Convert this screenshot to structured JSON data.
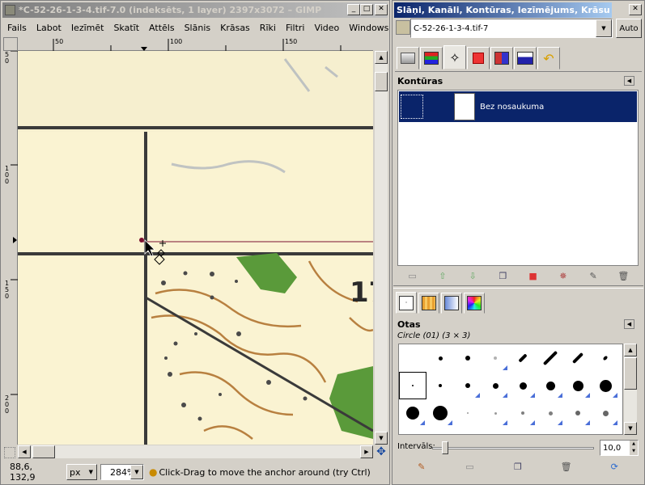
{
  "image_window": {
    "title": "*C-52-26-1-3-4.tif-7.0 (indeksēts, 1 layer) 2397x3072 – GIMP",
    "menu": [
      "Fails",
      "Labot",
      "Iezīmēt",
      "Skatīt",
      "Attēls",
      "Slānis",
      "Krāsas",
      "Rīki",
      "Filtri",
      "Video",
      "Windows",
      "Pa"
    ],
    "hruler_labels": [
      "50",
      "100",
      "150"
    ],
    "vruler_labels": [
      "5\n0",
      "1\n0\n0",
      "1\n5\n0",
      "2\n0\n0"
    ],
    "status": {
      "coords": "88,6, 132,9",
      "unit": "px",
      "zoom": "284%",
      "hint": "Click-Drag to move the anchor around (try Ctrl)"
    }
  },
  "dock": {
    "title": "Slāņi, Kanāli, Kontūras, Iezīmējums, Krāsu karte, ...",
    "image_select": "C-52-26-1-3-4.tif-7",
    "auto_button": "Auto",
    "paths_panel": {
      "title": "Kontūras",
      "items": [
        {
          "name": "Bez nosaukuma",
          "selected": true
        }
      ]
    },
    "brushes_panel": {
      "title": "Otas",
      "current_brush": "Circle (01) (3 × 3)",
      "spacing_label": "Intervāls:",
      "spacing_value": "10,0",
      "spacing_fraction": 0.08
    }
  },
  "colors": {
    "titlebar_active": "#0a246a",
    "selection": "#0a246a",
    "canvas_paper": "#f6efcf",
    "map_green": "#5a9a3a",
    "path_color": "#7a1030"
  }
}
